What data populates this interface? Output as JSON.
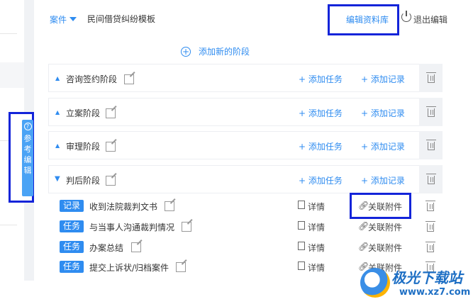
{
  "left": {
    "ref_tab_label": "参考编辑"
  },
  "header": {
    "case_label": "案件",
    "template_name": "民间借贷纠纷模板",
    "edit_library": "编辑资料库",
    "exit_edit": "退出编辑"
  },
  "add_stage_label": "添加新的阶段",
  "stages": [
    {
      "name": "咨询签约阶段",
      "add_task": "+ 添加任务",
      "add_record": "+ 添加记录",
      "expanded": false
    },
    {
      "name": "立案阶段",
      "add_task": "+ 添加任务",
      "add_record": "+ 添加记录",
      "expanded": false
    },
    {
      "name": "审理阶段",
      "add_task": "+ 添加任务",
      "add_record": "+ 添加记录",
      "expanded": false
    },
    {
      "name": "判后阶段",
      "add_task": "+ 添加任务",
      "add_record": "+ 添加记录",
      "expanded": true
    }
  ],
  "tasks": [
    {
      "badge": "记录",
      "title": "收到法院裁判文书",
      "detail": "详情",
      "attach": "关联附件"
    },
    {
      "badge": "任务",
      "title": "与当事人沟通裁判情况",
      "detail": "详情",
      "attach": "关联附件"
    },
    {
      "badge": "任务",
      "title": "办案总结",
      "detail": "详情",
      "attach": "关联附件"
    },
    {
      "badge": "任务",
      "title": "提交上诉状/归档案件",
      "detail": "详情",
      "attach": "关联附件"
    }
  ],
  "watermark": {
    "title": "极光下载站",
    "url": "www.xz7.com"
  },
  "colors": {
    "accent": "#2f8cf0",
    "highlight_box": "#1324d9"
  }
}
